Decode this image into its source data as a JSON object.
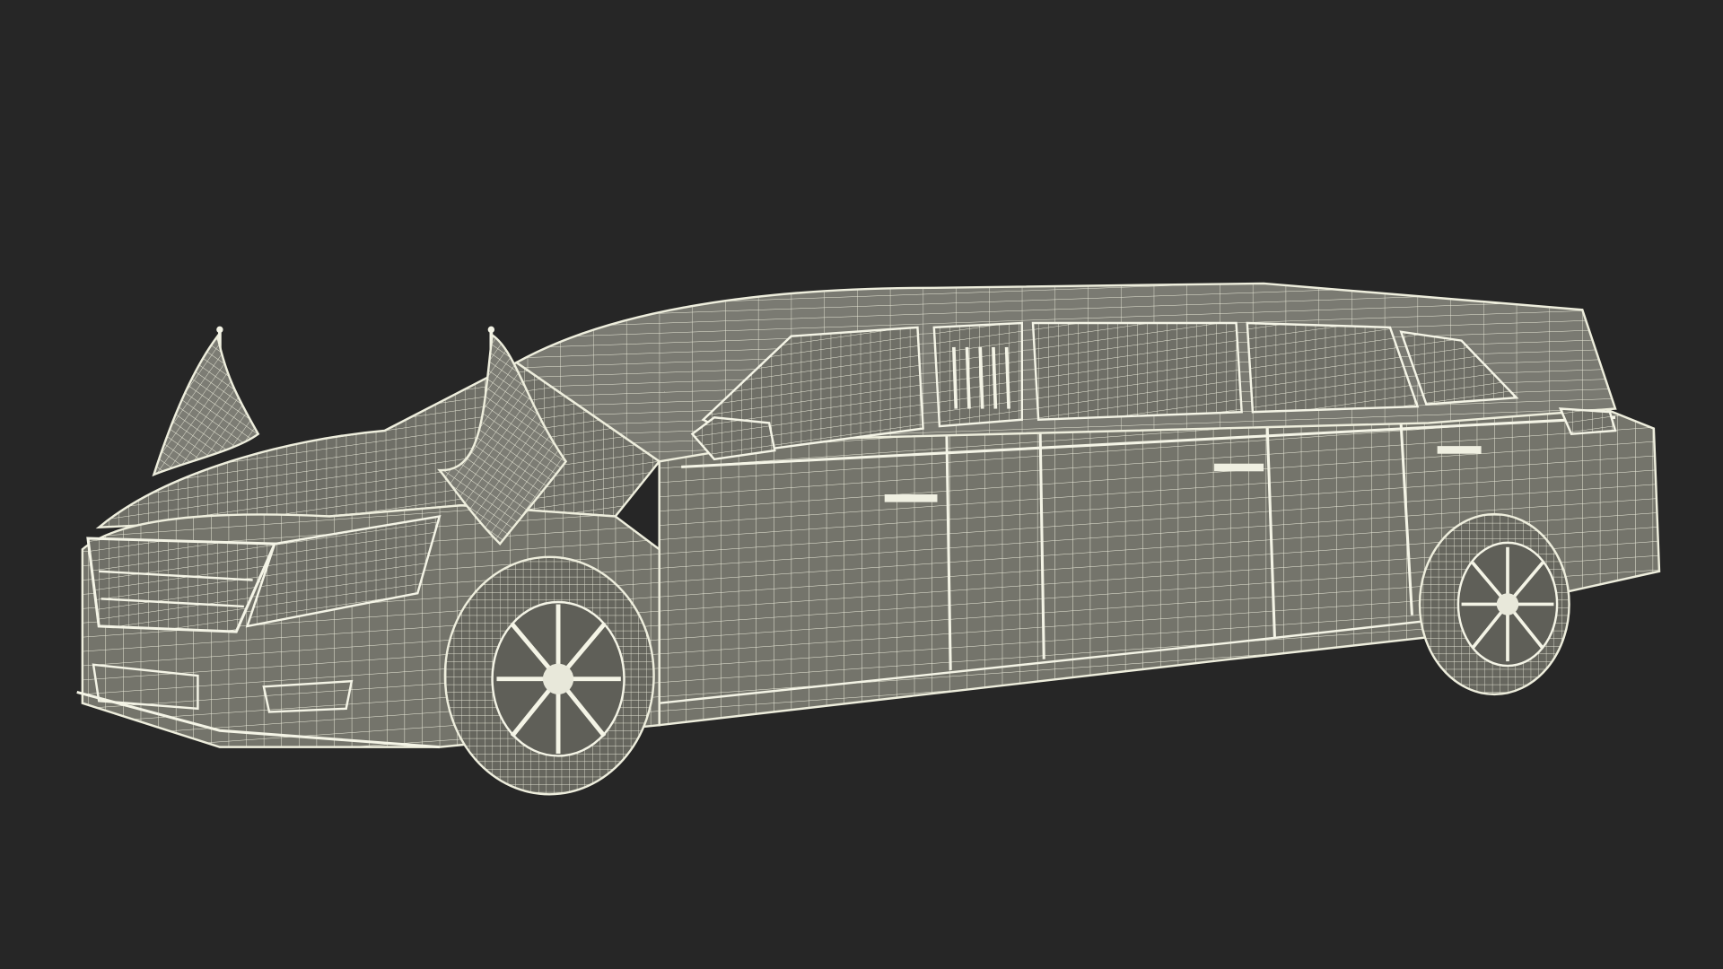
{
  "scene": {
    "subject": "limousine-wireframe-render",
    "background_color": "#262626",
    "wire_color": "#eeeedd",
    "surface_color": "#75756c",
    "glass_color": "#6e6e66",
    "tire_color": "#6a6a62",
    "flags": 2,
    "visible_wheels": 2
  }
}
